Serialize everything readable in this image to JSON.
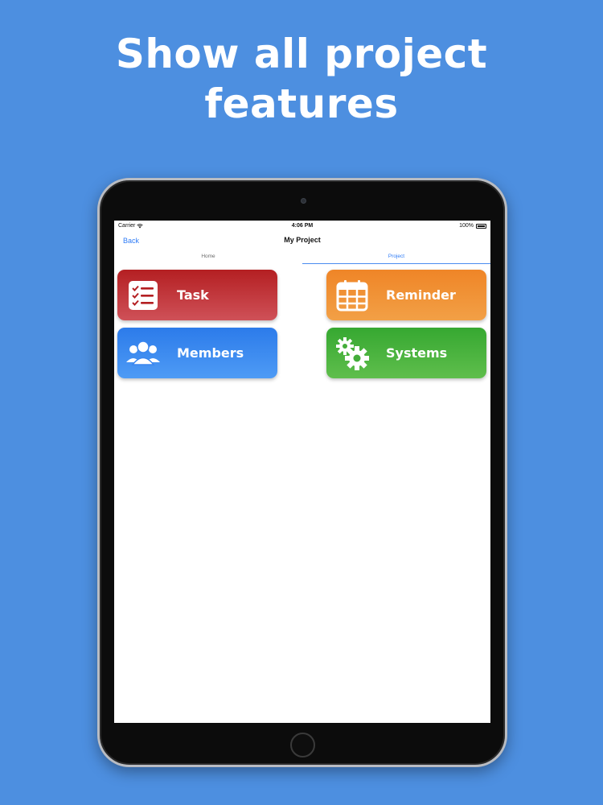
{
  "headline": {
    "line1": "Show all project",
    "line2": "features"
  },
  "status_bar": {
    "carrier": "Carrier",
    "time": "4:06 PM",
    "battery": "100%"
  },
  "nav": {
    "back_label": "Back",
    "title": "My Project"
  },
  "tabs": [
    {
      "label": "Home",
      "active": false
    },
    {
      "label": "Project",
      "active": true
    }
  ],
  "cards": [
    {
      "label": "Task",
      "icon": "checklist-icon",
      "color": "#b41f22"
    },
    {
      "label": "Reminder",
      "icon": "calendar-icon",
      "color": "#ef8527"
    },
    {
      "label": "Members",
      "icon": "people-icon",
      "color": "#2c7bea"
    },
    {
      "label": "Systems",
      "icon": "gears-icon",
      "color": "#36a831"
    }
  ],
  "colors": {
    "background": "#4d8fe0",
    "accent": "#2f7cf6"
  }
}
